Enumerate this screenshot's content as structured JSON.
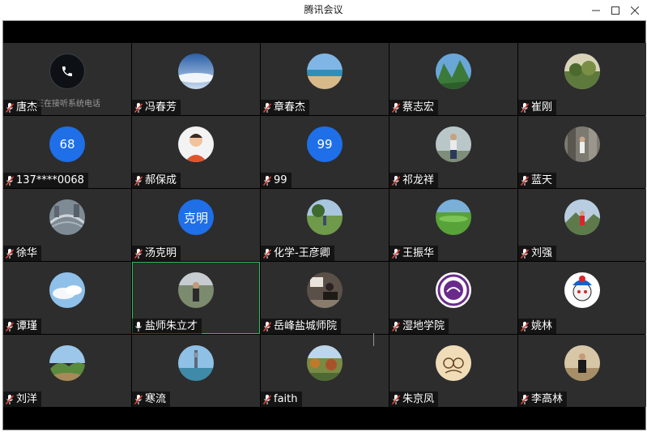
{
  "window": {
    "title": "腾讯会议"
  },
  "participants": [
    {
      "name": "唐杰",
      "avatar": "phone-icon",
      "status": "正在接听系统电话",
      "mic": "muted"
    },
    {
      "name": "冯春芳",
      "avatar": "photo-sky",
      "mic": "muted"
    },
    {
      "name": "章春杰",
      "avatar": "photo-beach",
      "mic": "muted"
    },
    {
      "name": "蔡志宏",
      "avatar": "photo-mountain",
      "mic": "muted"
    },
    {
      "name": "崔刚",
      "avatar": "photo-garden",
      "mic": "muted"
    },
    {
      "name": "137****0068",
      "avatar_text": "68",
      "mic": "muted"
    },
    {
      "name": "郝保成",
      "avatar": "photo-cartoon-man",
      "mic": "muted"
    },
    {
      "name": "99",
      "avatar_text": "99",
      "mic": "muted"
    },
    {
      "name": "祁龙祥",
      "avatar": "photo-person",
      "mic": "muted"
    },
    {
      "name": "蓝天",
      "avatar": "photo-person-street",
      "mic": "muted"
    },
    {
      "name": "徐华",
      "avatar": "photo-city",
      "mic": "muted"
    },
    {
      "name": "汤克明",
      "avatar_text": "克明",
      "mic": "muted"
    },
    {
      "name": "化学-王彦卿",
      "avatar": "photo-field",
      "mic": "muted"
    },
    {
      "name": "王振华",
      "avatar": "photo-green-field",
      "mic": "muted"
    },
    {
      "name": "刘强",
      "avatar": "photo-hiker",
      "mic": "muted"
    },
    {
      "name": "谭瑾",
      "avatar": "photo-clouds",
      "mic": "muted"
    },
    {
      "name": "盐师朱立才",
      "avatar": "photo-man-outdoor",
      "mic": "active"
    },
    {
      "name": "岳峰盐城师院",
      "avatar": "photo-desk",
      "mic": "muted"
    },
    {
      "name": "湿地学院",
      "avatar": "logo-purple-emblem",
      "mic": "muted"
    },
    {
      "name": "姚林",
      "avatar": "photo-cartoon-opera",
      "mic": "muted"
    },
    {
      "name": "刘洋",
      "avatar": "photo-hills",
      "mic": "muted"
    },
    {
      "name": "寒流",
      "avatar": "photo-tower",
      "mic": "muted"
    },
    {
      "name": "faith",
      "avatar": "photo-autumn",
      "mic": "muted"
    },
    {
      "name": "朱京凤",
      "avatar": "photo-drawing",
      "mic": "muted"
    },
    {
      "name": "李高林",
      "avatar": "photo-person-room",
      "mic": "muted"
    }
  ],
  "colors": {
    "tile_bg": "#2d2d2d",
    "text_avatar_bg": "#1e6fe8",
    "active_speaker_border": "#2fbf5a",
    "muted_mic": "#e0463c"
  }
}
